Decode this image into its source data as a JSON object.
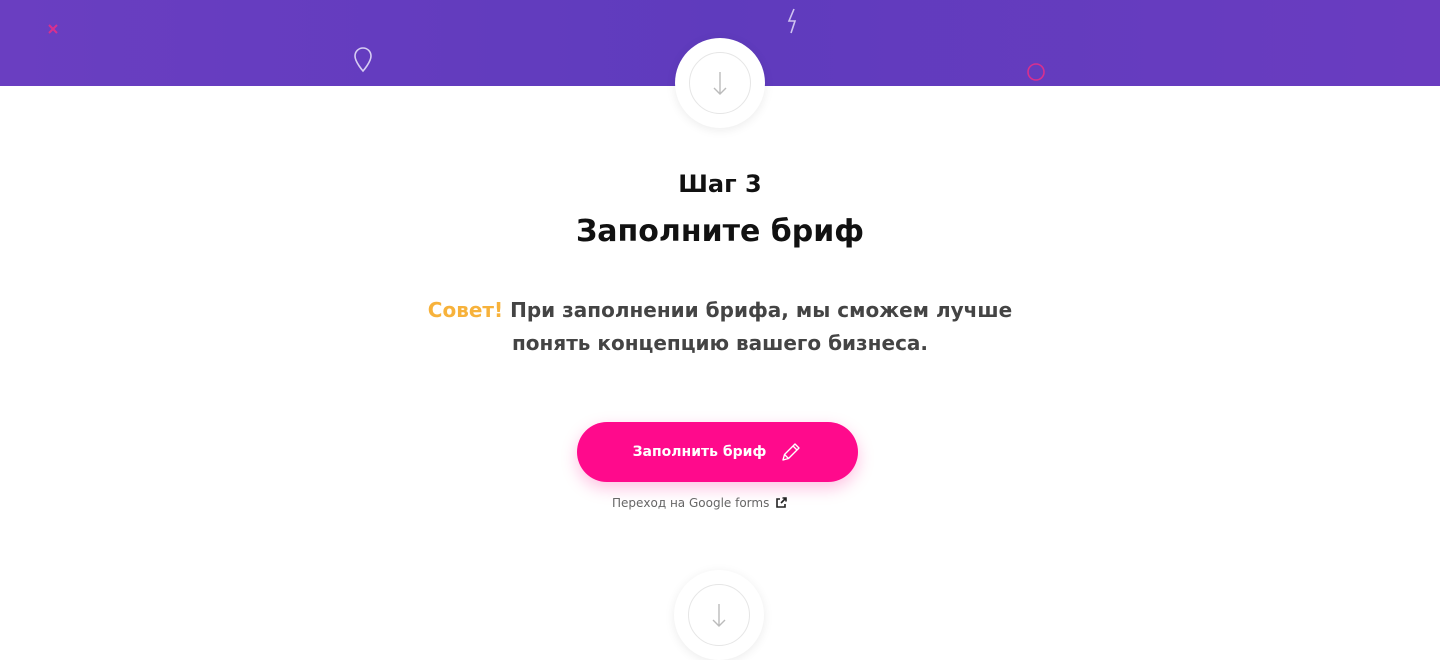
{
  "step": {
    "label": "Шаг 3",
    "title": "Заполните бриф"
  },
  "tip": {
    "highlight": "Совет!",
    "text": "При заполнении брифа, мы сможем лучше понять концепцию вашего бизнеса."
  },
  "cta": {
    "label": "Заполнить бриф",
    "icon": "pencil-icon"
  },
  "link": {
    "text": "Переход на Google forms",
    "icon": "external-link-icon"
  },
  "colors": {
    "band": "#6a3ec1",
    "accent": "#f7b23b",
    "cta": "#ff0a8c"
  }
}
